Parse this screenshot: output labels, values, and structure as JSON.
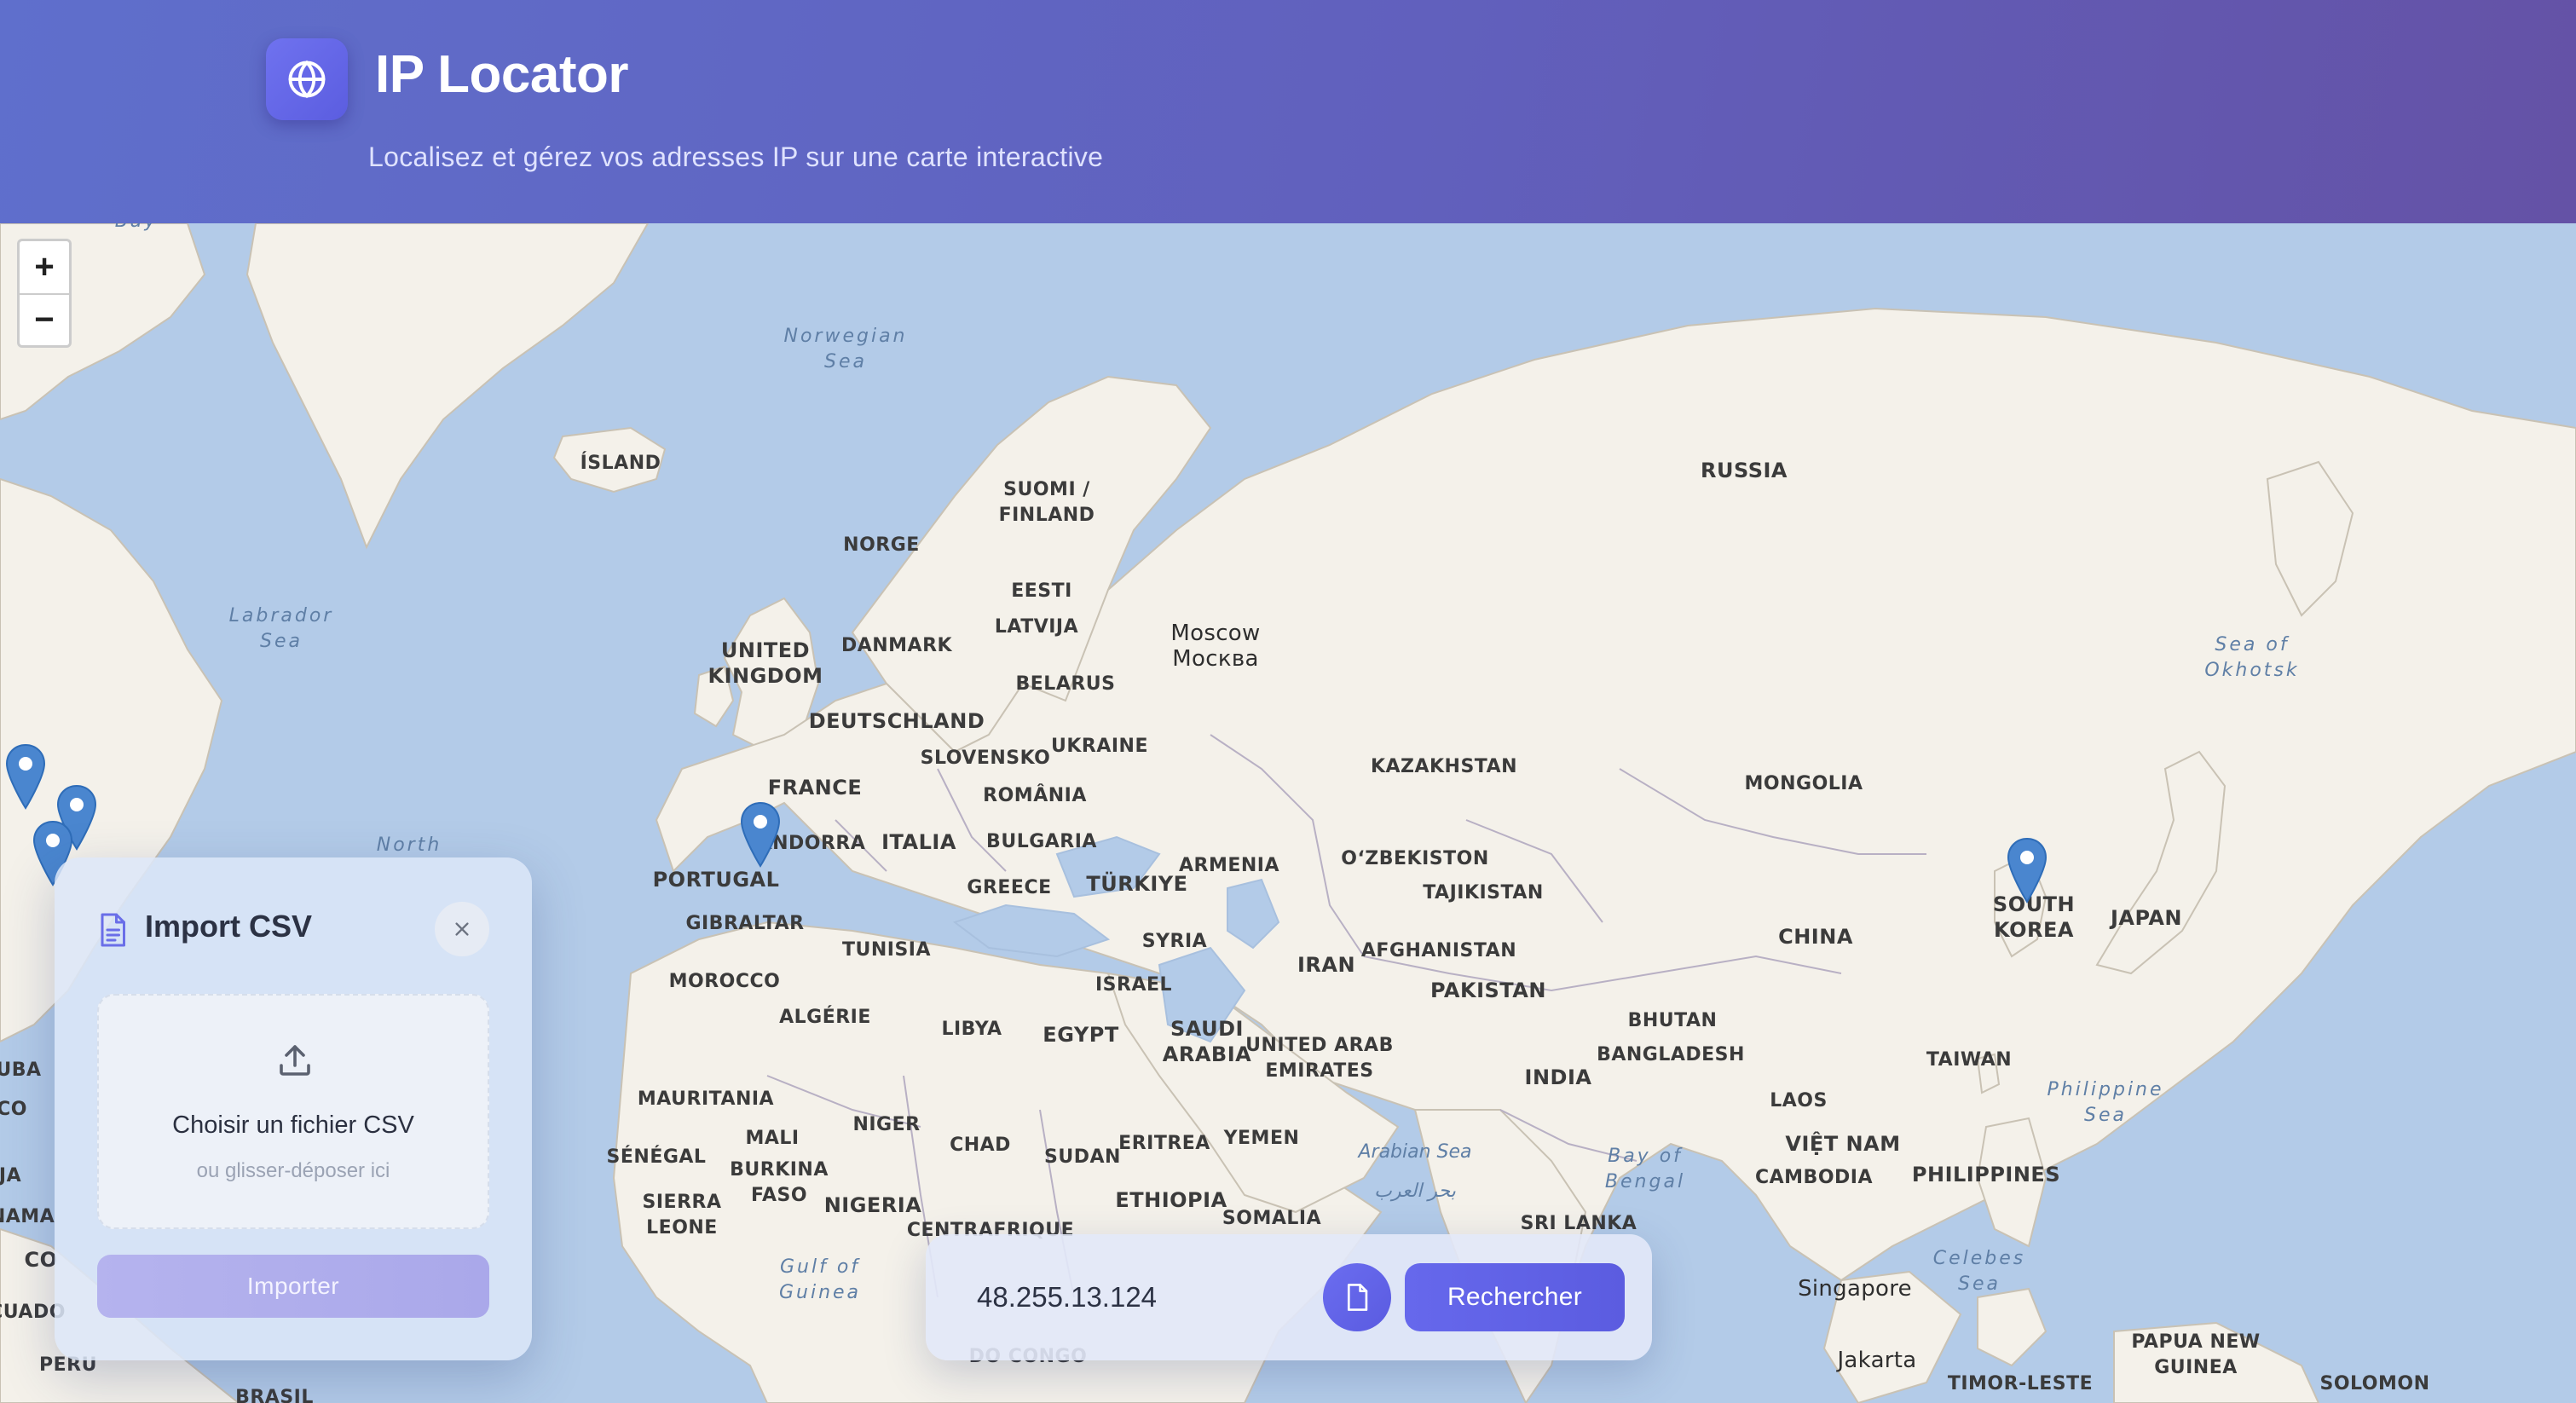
{
  "header": {
    "title": "IP Locator",
    "subtitle": "Localisez et gérez vos adresses IP sur une carte interactive",
    "logo_icon": "globe-icon"
  },
  "map": {
    "zoom_in": "+",
    "zoom_out": "−",
    "labels": {
      "bay": "Bay",
      "norwegian_sea": "Norwegian\nSea",
      "labrador_sea": "Labrador\nSea",
      "north": "North",
      "island": "ÍSLAND",
      "suomi": "SUOMI /\nFINLAND",
      "norge": "NORGE",
      "eesti": "EESTI",
      "latvija": "LATVIJA",
      "moscow": "Moscow\nМосква",
      "russia": "RUSSIA",
      "sea_okhotsk": "Sea of\nOkhotsk",
      "uk": "UNITED\nKINGDOM",
      "danmark": "DANMARK",
      "belarus": "BELARUS",
      "deutschland": "DEUTSCHLAND",
      "slovensko": "SLOVENSKO",
      "ukraine": "UKRAINE",
      "france": "FRANCE",
      "romania": "ROMÂNIA",
      "kazakhstan": "KAZAKHSTAN",
      "mongolia": "MONGOLIA",
      "andorra": "ANDORRA",
      "italia": "ITALIA",
      "bulgaria": "BULGARIA",
      "armenia": "ARMENIA",
      "uzbekistan": "OʻZBEKISTON",
      "tajikistan": "TAJIKISTAN",
      "portugal": "PORTUGAL",
      "greece": "GREECE",
      "turkiye": "TÜRKIYE",
      "south_korea": "SOUTH\nKOREA",
      "japan": "JAPAN",
      "gibraltar": "GIBRALTAR",
      "tunisia": "TUNISIA",
      "syria": "SYRIA",
      "iran": "IRAN",
      "afghanistan": "AFGHANISTAN",
      "china": "CHINA",
      "morocco": "MOROCCO",
      "israel": "ISRAEL",
      "pakistan": "PAKISTAN",
      "algerie": "ALGÉRIE",
      "libya": "LIBYA",
      "egypt": "EGYPT",
      "saudi": "SAUDI\nARABIA",
      "uae": "UNITED ARAB\nEMIRATES",
      "bhutan": "BHUTAN",
      "bangladesh": "BANGLADESH",
      "taiwan": "TAIWAN",
      "philippine_sea": "Philippine\nSea",
      "india": "INDIA",
      "mauritania": "MAURITANIA",
      "niger": "NIGER",
      "laos": "LAOS",
      "mali": "MALI",
      "chad": "CHAD",
      "eritrea": "ERITREA",
      "yemen": "YEMEN",
      "arabian_sea": "Arabian Sea",
      "arabian_sea_ar": "بحر العرب",
      "bay_bengal": "Bay of\nBengal",
      "vietnam": "VIỆT NAM",
      "senegal": "SÉNÉGAL",
      "burkina": "BURKINA\nFASO",
      "sudan": "SUDAN",
      "cambodia": "CAMBODIA",
      "philippines": "PHILIPPINES",
      "sierra_leone": "SIERRA\nLEONE",
      "nigeria": "NIGERIA",
      "ethiopia": "ETHIOPIA",
      "somalia": "SOMALIA",
      "centrafrique": "CENTRAFRIQUE",
      "sri_lanka": "SRI LANKA",
      "gulf_guinea": "Gulf of\nGuinea",
      "celebes": "Celebes\nSea",
      "singapore": "Singapore",
      "papua": "PAPUA NEW\nGUINEA",
      "jakarta": "Jakarta",
      "timor": "TIMOR-LESTE",
      "solomon": "SOLOMON",
      "peru": "PERU",
      "brasil": "BRASIL",
      "congo": "DO CONGO",
      "uba": "UBA",
      "co": "CO",
      "ja": "JA",
      "nama": "NAMA",
      "cuado": "CUADO",
      "co2": "CO"
    }
  },
  "import_panel": {
    "title": "Import CSV",
    "choose_label": "Choisir un fichier CSV",
    "drag_hint": "ou glisser-déposer ici",
    "import_button": "Importer"
  },
  "search": {
    "ip_value": "48.255.13.124",
    "search_button": "Rechercher"
  },
  "colors": {
    "accent": "#5b5ce0",
    "header_start": "#5f6fcc",
    "header_end": "#6452a6",
    "water": "#b3cbe8",
    "land": "#f4f1ea",
    "marker": "#4a86cf"
  }
}
